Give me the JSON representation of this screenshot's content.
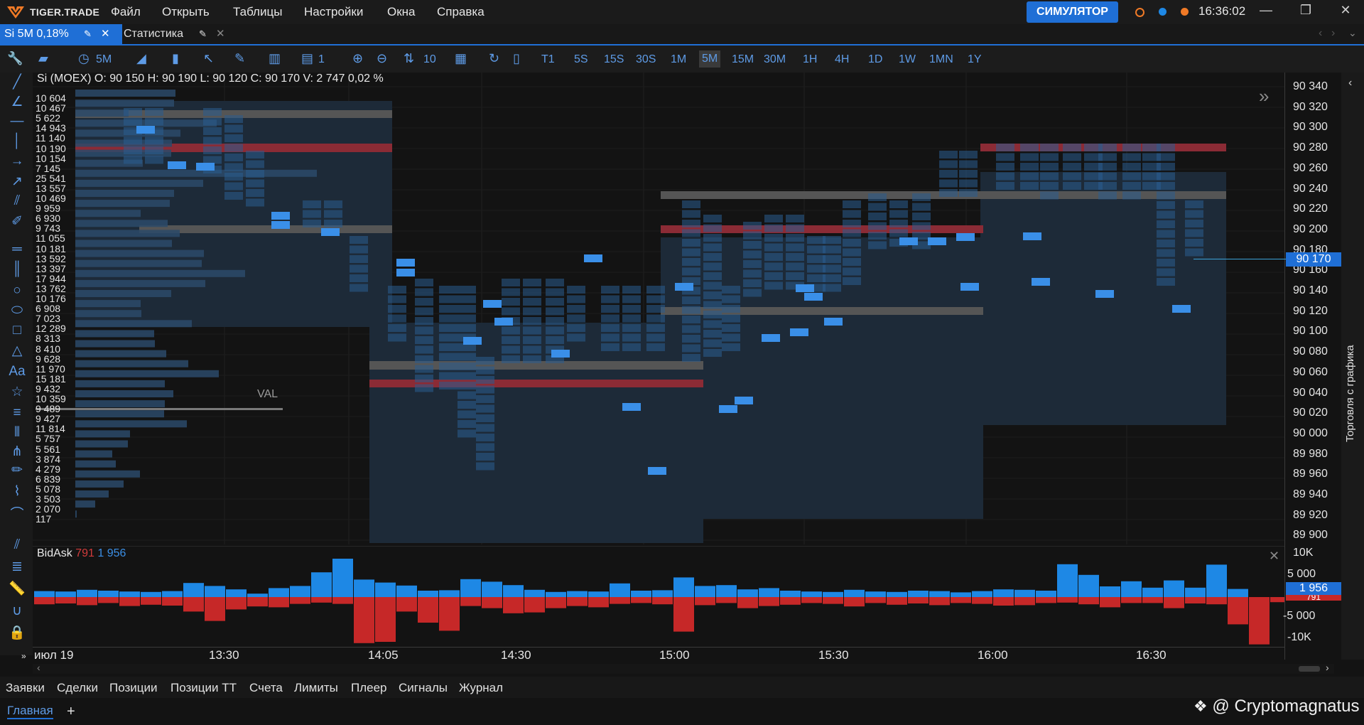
{
  "app": {
    "logo": "TIGER.TRADE",
    "menu": [
      "Файл",
      "Открыть",
      "Таблицы",
      "Настройки",
      "Окна",
      "Справка"
    ],
    "simulator_label": "СИМУЛЯТОР",
    "clock": "16:36:02",
    "window_controls": [
      "—",
      "❐",
      "✕"
    ]
  },
  "tabs": [
    {
      "label": "Si 5M  0,18%"
    },
    {
      "label": "Статистика"
    }
  ],
  "toolbar": {
    "timeframe": "5M",
    "count": "1",
    "step": "10",
    "timeframes": [
      "T1",
      "5S",
      "15S",
      "30S",
      "1M",
      "5M",
      "15M",
      "30M",
      "1H",
      "4H",
      "1D",
      "1W",
      "1MN",
      "1Y"
    ],
    "active_timeframe": "5M"
  },
  "chart": {
    "title": "Si (MOEX) O: 90 150  H: 90 190  L: 90 120  C: 90 170  V: 2 747  0,02 %",
    "val_label": "VAL",
    "price_levels": [
      "90 340",
      "90 320",
      "90 300",
      "90 280",
      "90 260",
      "90 240",
      "90 220",
      "90 200",
      "90 180",
      "90 170",
      "90 160",
      "90 140",
      "90 120",
      "90 100",
      "90 080",
      "90 060",
      "90 040",
      "90 020",
      "90 000",
      "89 980",
      "89 960",
      "89 940",
      "89 920",
      "89 900"
    ],
    "current_price": "90 170",
    "volume_profile": [
      "10 604",
      "10 467",
      "5 622",
      "14 943",
      "11 140",
      "10 190",
      "10 154",
      "7 145",
      "25 541",
      "13 557",
      "10 469",
      "9 959",
      "6 930",
      "9 743",
      "11 055",
      "10 181",
      "13 592",
      "13 397",
      "17 944",
      "13 762",
      "10 176",
      "6 908",
      "7 023",
      "12 289",
      "8 313",
      "8 410",
      "9 628",
      "11 970",
      "15 181",
      "9 432",
      "10 359",
      "9 489",
      "9 427",
      "11 814",
      "5 757",
      "5 561",
      "3 874",
      "4 279",
      "6 839",
      "5 078",
      "3 503",
      "2 070",
      "117"
    ],
    "side_label": "Торговля с графика",
    "time_labels": [
      "июл 19",
      "13:30",
      "14:05",
      "14:30",
      "15:00",
      "15:30",
      "16:00",
      "16:30"
    ]
  },
  "bidask": {
    "title": "BidAsk",
    "bid": "791",
    "ask": "1 956",
    "axis": [
      "10K",
      "5 000",
      "-5 000",
      "-10K"
    ],
    "current": "1 956",
    "current_red": "791",
    "colors": {
      "ask": "#1e88e5",
      "bid": "#c62828"
    }
  },
  "bottom_tabs": [
    "Заявки",
    "Сделки",
    "Позиции",
    "Позиции TT",
    "Счета",
    "Лимиты",
    "Плеер",
    "Сигналы",
    "Журнал"
  ],
  "workspace": {
    "main": "Главная",
    "add": "+"
  },
  "watermark": "@ Cryptomagnatus",
  "chart_data": {
    "type": "bar",
    "title": "BidAsk",
    "ylim": [
      -10000,
      10000
    ],
    "series": [
      {
        "name": "Ask",
        "values": [
          1400,
          1300,
          1700,
          1500,
          1300,
          1200,
          1400,
          3300,
          2600,
          1800,
          800,
          2100,
          2600,
          5800,
          9000,
          4100,
          3400,
          2700,
          1500,
          1600,
          4200,
          3600,
          2800,
          1700,
          1200,
          1400,
          1300,
          3200,
          1500,
          1600,
          4600,
          2600,
          2800,
          1800,
          2100,
          1500,
          1300,
          1200,
          1700,
          1300,
          1200,
          1500,
          1400,
          1100,
          1400,
          1800,
          1700,
          1500,
          7700,
          5200,
          2500,
          3700,
          2200,
          3900,
          2200,
          7600,
          1900
        ]
      },
      {
        "name": "Bid",
        "values": [
          -1700,
          -1500,
          -1900,
          -1400,
          -2100,
          -1800,
          -2000,
          -3400,
          -5600,
          -2900,
          -2200,
          -2400,
          -1600,
          -1300,
          -1600,
          -10800,
          -10500,
          -3400,
          -6000,
          -7900,
          -2100,
          -2600,
          -3800,
          -3600,
          -2600,
          -2100,
          -2400,
          -1600,
          -1400,
          -1700,
          -8100,
          -1900,
          -1400,
          -2600,
          -2100,
          -1800,
          -1400,
          -1600,
          -2200,
          -1400,
          -1800,
          -1500,
          -1900,
          -1400,
          -1600,
          -2000,
          -1900,
          -1400,
          -1300,
          -1700,
          -2400,
          -1400,
          -1400,
          -2600,
          -1500,
          -1700,
          -6400,
          -11100,
          -1200
        ]
      }
    ]
  }
}
